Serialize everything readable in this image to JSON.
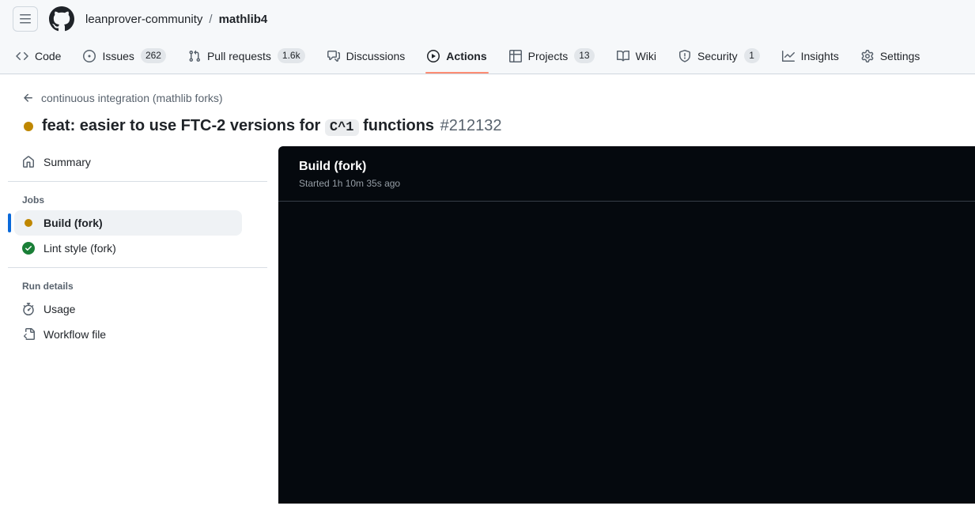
{
  "header": {
    "hamburger_icon": "three-bars-icon",
    "logo_icon": "github-mark-icon",
    "breadcrumb": {
      "owner": "leanprover-community",
      "separator": "/",
      "repo": "mathlib4"
    }
  },
  "nav": {
    "tabs": [
      {
        "icon": "code-icon",
        "label": "Code"
      },
      {
        "icon": "issue-opened-icon",
        "label": "Issues",
        "count": "262"
      },
      {
        "icon": "git-pull-request-icon",
        "label": "Pull requests",
        "count": "1.6k"
      },
      {
        "icon": "comment-discussion-icon",
        "label": "Discussions"
      },
      {
        "icon": "play-icon",
        "label": "Actions",
        "active": true
      },
      {
        "icon": "table-icon",
        "label": "Projects",
        "count": "13"
      },
      {
        "icon": "book-icon",
        "label": "Wiki"
      },
      {
        "icon": "shield-icon",
        "label": "Security",
        "count": "1"
      },
      {
        "icon": "graph-icon",
        "label": "Insights"
      },
      {
        "icon": "gear-icon",
        "label": "Settings"
      }
    ]
  },
  "run_header": {
    "back_icon": "arrow-left-icon",
    "back_label": "continuous integration (mathlib forks)",
    "status": "in_progress",
    "title_prefix": "feat: easier to use FTC-2 versions for",
    "title_code": "C^1",
    "title_suffix": "functions",
    "run_number": "#212132"
  },
  "sidebar": {
    "summary": {
      "icon": "home-icon",
      "label": "Summary"
    },
    "jobs_heading": "Jobs",
    "jobs": [
      {
        "icon": "dot-fill-icon",
        "label": "Build (fork)",
        "status": "in_progress",
        "selected": true
      },
      {
        "icon": "check-circle-icon",
        "label": "Lint style (fork)",
        "status": "success",
        "selected": false
      }
    ],
    "run_details_heading": "Run details",
    "run_details": [
      {
        "icon": "stopwatch-icon",
        "label": "Usage"
      },
      {
        "icon": "file-code-icon",
        "label": "Workflow file"
      }
    ]
  },
  "log_panel": {
    "title": "Build (fork)",
    "started": "Started 1h 10m 35s ago"
  },
  "colors": {
    "header_bg": "#f6f8fa",
    "border": "#d0d7de",
    "text": "#1f2328",
    "text_muted": "#59636e",
    "tab_underline": "#fd8c73",
    "status_in_progress": "#bf8700",
    "status_success": "#1a7f37",
    "selection_accent": "#0969da",
    "selected_row_bg": "#eff2f5",
    "log_bg": "#05090e"
  }
}
